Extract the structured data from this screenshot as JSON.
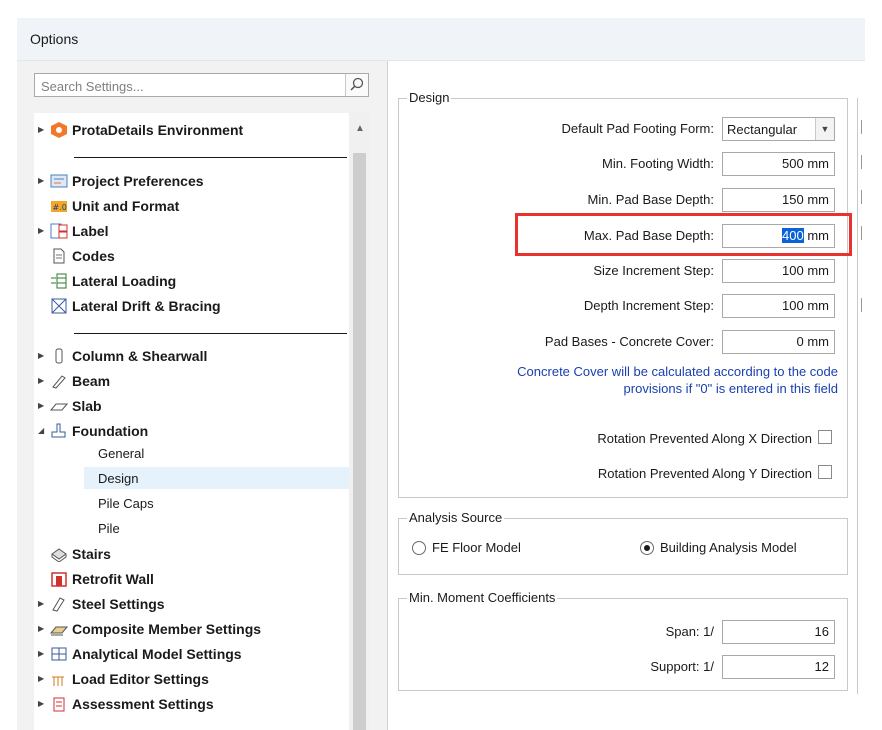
{
  "window": {
    "title": "Options"
  },
  "search": {
    "placeholder": "Search Settings...",
    "icon": "search-icon"
  },
  "tree": {
    "items": [
      {
        "label": "ProtaDetails Environment",
        "icon": "prota-logo-icon",
        "arrow": "▶"
      },
      {
        "label": "Project Preferences",
        "icon": "project-preferences-icon",
        "arrow": "▶"
      },
      {
        "label": "Unit and Format",
        "icon": "unit-format-icon",
        "arrow": ""
      },
      {
        "label": "Label",
        "icon": "label-icon",
        "arrow": "▶"
      },
      {
        "label": "Codes",
        "icon": "document-icon",
        "arrow": ""
      },
      {
        "label": "Lateral Loading",
        "icon": "lateral-loading-icon",
        "arrow": ""
      },
      {
        "label": "Lateral Drift & Bracing",
        "icon": "bracing-icon",
        "arrow": ""
      },
      {
        "label": "Column & Shearwall",
        "icon": "column-icon",
        "arrow": "▶"
      },
      {
        "label": "Beam",
        "icon": "beam-icon",
        "arrow": "▶"
      },
      {
        "label": "Slab",
        "icon": "slab-icon",
        "arrow": "▶"
      },
      {
        "label": "Foundation",
        "icon": "foundation-icon",
        "arrow": "◢"
      },
      {
        "label": "General"
      },
      {
        "label": "Design"
      },
      {
        "label": "Pile Caps"
      },
      {
        "label": "Pile"
      },
      {
        "label": "Stairs",
        "icon": "stairs-icon",
        "arrow": ""
      },
      {
        "label": "Retrofit Wall",
        "icon": "retrofit-wall-icon",
        "arrow": ""
      },
      {
        "label": "Steel Settings",
        "icon": "steel-icon",
        "arrow": "▶"
      },
      {
        "label": "Composite Member Settings",
        "icon": "composite-icon",
        "arrow": "▶"
      },
      {
        "label": "Analytical Model Settings",
        "icon": "analytical-model-icon",
        "arrow": "▶"
      },
      {
        "label": "Load Editor Settings",
        "icon": "load-editor-icon",
        "arrow": "▶"
      },
      {
        "label": "Assessment Settings",
        "icon": "assessment-icon",
        "arrow": "▶"
      }
    ],
    "selected": "Design"
  },
  "design": {
    "group_title": "Design",
    "default_form_label": "Default Pad Footing Form:",
    "default_form_value": "Rectangular",
    "min_width_label": "Min. Footing Width:",
    "min_width_value": "500 mm",
    "min_depth_label": "Min. Pad Base Depth:",
    "min_depth_value": "150 mm",
    "max_depth_label": "Max. Pad Base Depth:",
    "max_depth_value_selected": "400",
    "max_depth_value_unit": " mm",
    "size_step_label": "Size Increment Step:",
    "size_step_value": "100 mm",
    "depth_step_label": "Depth Increment Step:",
    "depth_step_value": "100 mm",
    "cover_label": "Pad Bases - Concrete Cover:",
    "cover_value": "0 mm",
    "note_line1": "Concrete Cover will be calculated according to the code",
    "note_line2": "provisions if \"0\" is entered in this field",
    "rot_x_label": "Rotation Prevented Along X Direction",
    "rot_y_label": "Rotation Prevented Along Y Direction"
  },
  "analysis": {
    "group_title": "Analysis Source",
    "option1": "FE Floor Model",
    "option2": "Building Analysis Model",
    "selected": "Building Analysis Model"
  },
  "moment": {
    "group_title": "Min. Moment Coefficients",
    "span_label": "Span: 1/",
    "span_value": "16",
    "support_label": "Support: 1/",
    "support_value": "12"
  },
  "colors": {
    "highlight": "#e8322f",
    "note_text": "#1a3fb0",
    "selection": "#0a63d8",
    "tree_selected": "#e5f1fb"
  }
}
